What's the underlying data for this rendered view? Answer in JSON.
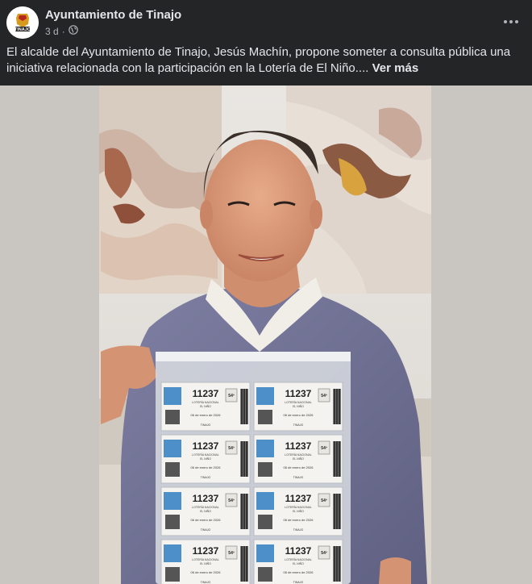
{
  "post": {
    "page_name": "Ayuntamiento de Tinajo",
    "time": "3 d",
    "separator": "·",
    "audience_icon": "globe-icon",
    "more_icon": "ellipsis-icon",
    "caption": "El alcalde del Ayuntamiento de Tinajo, Jesús Machín, propone someter a consulta pública una iniciativa relacionada con la participación en la Lotería de El Niño....",
    "see_more": "Ver más",
    "avatar_label": "TINAJO"
  },
  "tickets": {
    "number": "11237",
    "series": "54º",
    "header": "LOTERÍA NACIONAL",
    "sub": "EL NIÑO",
    "date": "06 de enero de 2026",
    "place": "TINAJO"
  }
}
